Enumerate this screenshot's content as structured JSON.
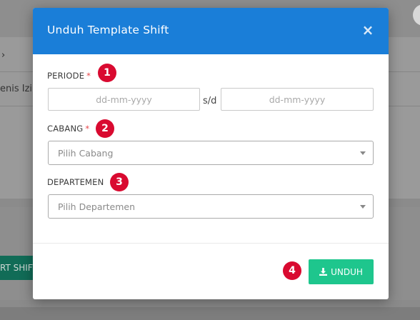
{
  "background": {
    "breadcrumb_chevron": "›",
    "jenis_izin_text": "enis Izin",
    "green_button_label": "RT SHIFT"
  },
  "modal": {
    "title": "Unduh Template Shift",
    "close_symbol": "×",
    "periode": {
      "label": "PERIODE",
      "required_mark": "*",
      "start_placeholder": "dd-mm-yyyy",
      "separator": "s/d",
      "end_placeholder": "dd-mm-yyyy",
      "badge": "1"
    },
    "cabang": {
      "label": "CABANG",
      "required_mark": "*",
      "placeholder": "Pilih Cabang",
      "badge": "2"
    },
    "departemen": {
      "label": "DEPARTEMEN",
      "placeholder": "Pilih Departemen",
      "badge": "3"
    },
    "footer": {
      "download_label": "UNDUH",
      "badge": "4"
    }
  },
  "colors": {
    "header_blue": "#1a7ed8",
    "download_green": "#1ec68d",
    "badge_red": "#d90a30",
    "required_red": "#e8464a"
  },
  "icons": {
    "close": "close-icon",
    "download": "download-icon",
    "dropdown": "chevron-down-icon"
  }
}
